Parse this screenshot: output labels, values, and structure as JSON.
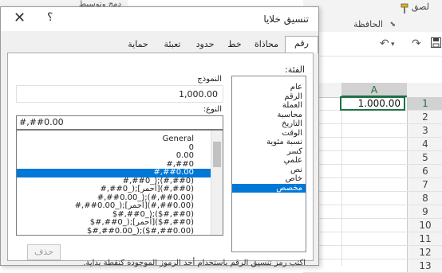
{
  "topstrip": {
    "label": "دمج وتوسيط"
  },
  "ribbon": {
    "paste_label": "لصق",
    "clipboard_label": "الحافظة"
  },
  "sheet": {
    "column_a": "A",
    "rows": [
      "1",
      "2",
      "3",
      "4",
      "5",
      "6",
      "7",
      "8",
      "9",
      "10",
      "11",
      "12",
      "13"
    ],
    "a1_value": "1.000.00"
  },
  "dialog": {
    "title": "تنسيق خلايا",
    "help": "؟",
    "close": "✕",
    "tabs": [
      "رقم",
      "محاذاة",
      "خط",
      "حدود",
      "تعبئة",
      "حماية"
    ],
    "category_label": "الفئة:",
    "categories": [
      "عام",
      "الرقم",
      "العملة",
      "محاسبة",
      "التاريخ",
      "الوقت",
      "نسبة مئوية",
      "كسر",
      "علمي",
      "نص",
      "خاص",
      "مخصص"
    ],
    "selected_category": "مخصص",
    "sample_label": "النموذج",
    "sample_value": "1,000.00",
    "type_label": "النوع:",
    "type_value": "#,##0.00",
    "types": [
      "General",
      "0",
      "0.00",
      "#,##0",
      "#,##0.00",
      "#,##0_);(#,##0)",
      "#,##0_);[أحمر](#,##0)",
      "#,##0.00_);(#,##0.00)",
      "#,##0.00_);[أحمر](#,##0.00)",
      "$#,##0_);($#,##0)",
      "$#,##0_);[أحمر]($#,##0)",
      "$#,##0.00_);($#,##0.00)"
    ],
    "selected_type": "#,##0.00",
    "delete_label": "حذف",
    "footer": "اكتب رمز تنسيق الرقم باستخدام أحد الرموز الموجودة كنقطة بداية."
  },
  "colors": {
    "accent": "#0078d7",
    "excel_green": "#1d7044"
  }
}
